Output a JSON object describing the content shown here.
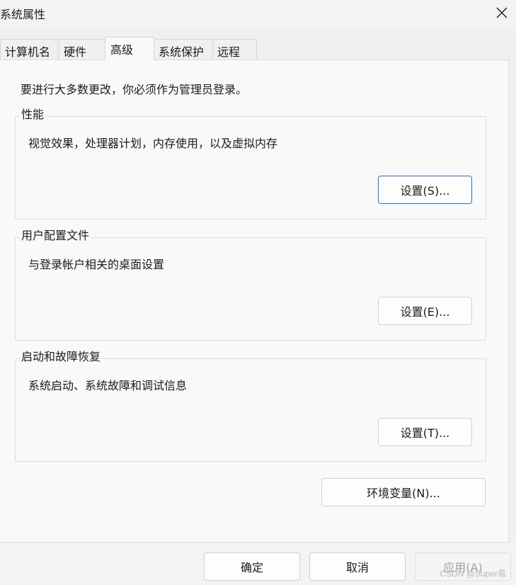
{
  "window": {
    "title": "系统属性"
  },
  "tabs": [
    {
      "label": "计算机名"
    },
    {
      "label": "硬件"
    },
    {
      "label": "高级"
    },
    {
      "label": "系统保护"
    },
    {
      "label": "远程"
    }
  ],
  "active_tab": "高级",
  "intro_text": "要进行大多数更改，你必须作为管理员登录。",
  "groups": [
    {
      "title": "性能",
      "description": "视觉效果，处理器计划，内存使用，以及虚拟内存",
      "button_label": "设置(S)..."
    },
    {
      "title": "用户配置文件",
      "description": "与登录帐户相关的桌面设置",
      "button_label": "设置(E)..."
    },
    {
      "title": "启动和故障恢复",
      "description": "系统启动、系统故障和调试信息",
      "button_label": "设置(T)..."
    }
  ],
  "env_button_label": "环境变量(N)...",
  "footer": {
    "ok_label": "确定",
    "cancel_label": "取消",
    "apply_label": "应用(A)"
  },
  "watermark": "CSDN @Super易",
  "colors": {
    "focus_border": "#2f6db5",
    "panel_bg": "#f9f9f9",
    "window_bg": "#f0f0f0"
  }
}
